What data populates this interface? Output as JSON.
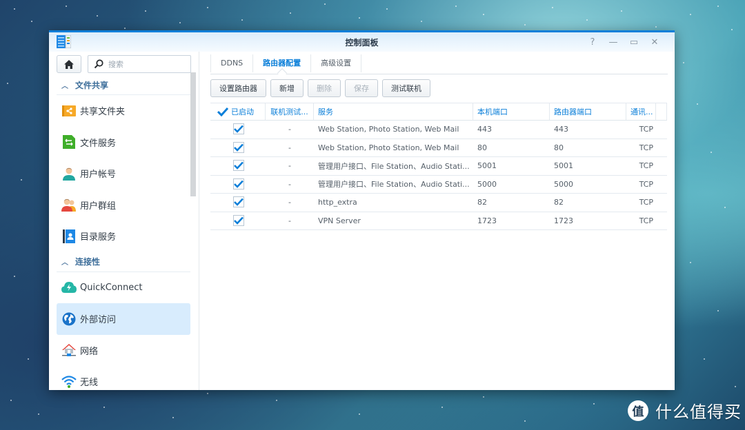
{
  "window": {
    "title": "控制面板",
    "controls": [
      {
        "name": "help",
        "glyph": "?"
      },
      {
        "name": "minimize",
        "glyph": "—"
      },
      {
        "name": "maximize",
        "glyph": "▭"
      },
      {
        "name": "close",
        "glyph": "✕"
      }
    ]
  },
  "sidebar": {
    "search_placeholder": "搜索",
    "sections": [
      {
        "label": "文件共享",
        "items": [
          {
            "label": "共享文件夹",
            "icon": "shared-folder-icon"
          },
          {
            "label": "文件服务",
            "icon": "file-services-icon"
          },
          {
            "label": "用户帐号",
            "icon": "user-icon"
          },
          {
            "label": "用户群组",
            "icon": "group-icon"
          },
          {
            "label": "目录服务",
            "icon": "directory-icon"
          }
        ]
      },
      {
        "label": "连接性",
        "items": [
          {
            "label": "QuickConnect",
            "icon": "quickconnect-icon"
          },
          {
            "label": "外部访问",
            "icon": "globe-icon",
            "active": true
          },
          {
            "label": "网络",
            "icon": "network-icon"
          },
          {
            "label": "无线",
            "icon": "wifi-icon"
          }
        ]
      }
    ]
  },
  "tabs": [
    {
      "label": "DDNS"
    },
    {
      "label": "路由器配置",
      "active": true
    },
    {
      "label": "高级设置"
    }
  ],
  "toolbar": {
    "setup_router": "设置路由器",
    "add": "新增",
    "delete": "删除",
    "save": "保存",
    "test_connection": "测试联机"
  },
  "table": {
    "columns": [
      "已启动",
      "联机测试...",
      "服务",
      "本机端口",
      "路由器端口",
      "通讯..."
    ],
    "rows": [
      {
        "enabled": true,
        "test": "-",
        "service": "Web Station, Photo Station, Web Mail",
        "local_port": "443",
        "router_port": "443",
        "protocol": "TCP"
      },
      {
        "enabled": true,
        "test": "-",
        "service": "Web Station, Photo Station, Web Mail",
        "local_port": "80",
        "router_port": "80",
        "protocol": "TCP"
      },
      {
        "enabled": true,
        "test": "-",
        "service": "管理用户接口、File Station、Audio Stati...",
        "local_port": "5001",
        "router_port": "5001",
        "protocol": "TCP"
      },
      {
        "enabled": true,
        "test": "-",
        "service": "管理用户接口、File Station、Audio Stati...",
        "local_port": "5000",
        "router_port": "5000",
        "protocol": "TCP"
      },
      {
        "enabled": true,
        "test": "-",
        "service": "http_extra",
        "local_port": "82",
        "router_port": "82",
        "protocol": "TCP"
      },
      {
        "enabled": true,
        "test": "-",
        "service": "VPN Server",
        "local_port": "1723",
        "router_port": "1723",
        "protocol": "TCP"
      }
    ]
  },
  "watermark": {
    "badge": "值",
    "text": "什么值得买"
  },
  "colors": {
    "accent": "#0b7fd9",
    "active_bg": "#d8ecfd"
  }
}
